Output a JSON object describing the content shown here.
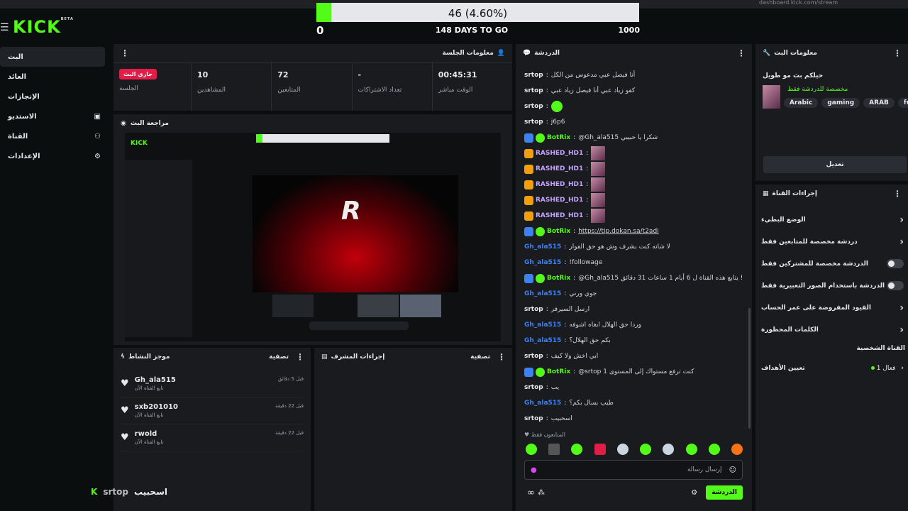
{
  "goal": {
    "label": "46 (4.60%)",
    "progress": 0.046,
    "min": "0",
    "days_left": "148 DAYS TO GO",
    "max": "1000"
  },
  "topbar": {
    "url_fragment": "dashboard.kick.com/stream",
    "logo_text": "KICK",
    "logo_sup": "BETA"
  },
  "sidebar": {
    "items": [
      {
        "label": "البث",
        "icon": ""
      },
      {
        "label": "العائد",
        "icon": ""
      },
      {
        "label": "الإنجازات",
        "icon": ""
      },
      {
        "label": "الاستديو",
        "icon": "screen-icon"
      },
      {
        "label": "القناة",
        "icon": "people-icon"
      },
      {
        "label": "الإعدادات",
        "icon": "gear-icon"
      }
    ]
  },
  "session": {
    "title": "معلومات الجلسة",
    "live_badge": "جاري البث",
    "live_label": "الجلسة",
    "stats": [
      {
        "value": "10",
        "label": "المشاهدين"
      },
      {
        "value": "72",
        "label": "المتابعين"
      },
      {
        "value": "-",
        "label": "تعداد الاشتراكات"
      },
      {
        "value": "00:45:31",
        "label": "الوقت مباشر"
      }
    ]
  },
  "preview": {
    "title": "مراجعة البث"
  },
  "activity": {
    "title": "موجز النشاط",
    "filter": "تصفية",
    "items": [
      {
        "user": "Gh_ala515",
        "desc": "تابع القناة الآن",
        "time": "قبل 5 دقائق"
      },
      {
        "user": "sxb201010",
        "desc": "تابع القناة الآن",
        "time": "قبل 22 دقيقة"
      },
      {
        "user": "rwold",
        "desc": "تابع القناة الآن",
        "time": "قبل 22 دقيقة"
      }
    ]
  },
  "mod": {
    "title": "إجراءات المشرف",
    "filter": "تصفية"
  },
  "footer_user": {
    "name": "srtop",
    "caption": "اسحبيب"
  },
  "chat": {
    "title": "الدردشة",
    "messages": [
      {
        "user": "srtop",
        "color": "#e5e7eb",
        "text": "أنا فيصل عبي مدعوس من الكل",
        "kind": "plain"
      },
      {
        "user": "srtop",
        "color": "#e5e7eb",
        "text": "كفو زياد عبي أنا فيصل زياد عبي",
        "kind": "plain"
      },
      {
        "user": "srtop",
        "color": "#e5e7eb",
        "text": "",
        "kind": "emote"
      },
      {
        "user": "srtop",
        "color": "#e5e7eb",
        "text": "j6p6",
        "kind": "plain"
      },
      {
        "user": "BotRix",
        "color": "#53fc18",
        "text": "@Gh_ala515 شكرا يا حبيبي",
        "kind": "bot"
      },
      {
        "user": "RASHED_HD1",
        "color": "#c4a2ff",
        "text": "",
        "kind": "crown"
      },
      {
        "user": "RASHED_HD1",
        "color": "#c4a2ff",
        "text": "",
        "kind": "crown"
      },
      {
        "user": "RASHED_HD1",
        "color": "#c4a2ff",
        "text": "",
        "kind": "crown"
      },
      {
        "user": "RASHED_HD1",
        "color": "#c4a2ff",
        "text": "",
        "kind": "crown"
      },
      {
        "user": "RASHED_HD1",
        "color": "#c4a2ff",
        "text": "",
        "kind": "crown"
      },
      {
        "user": "BotRix",
        "color": "#53fc18",
        "text": "https://tip.dokan.sa/t2adi",
        "kind": "bot"
      },
      {
        "user": "Gh_ala515",
        "color": "#3b82f6",
        "text": "لا شاته كنت بشرف وش هو حق الفوار",
        "kind": "plain"
      },
      {
        "user": "Gh_ala515",
        "color": "#3b82f6",
        "text": "!followage",
        "kind": "plain"
      },
      {
        "user": "BotRix",
        "color": "#53fc18",
        "text": "@Gh_ala515 يتابع هذه القناة ل 6 أيام 1 ساعات 31 دقائق !",
        "kind": "bot"
      },
      {
        "user": "Gh_ala515",
        "color": "#3b82f6",
        "text": "جوي ورني",
        "kind": "plain"
      },
      {
        "user": "srtop",
        "color": "#e5e7eb",
        "text": "ارسل السيرفر",
        "kind": "plain"
      },
      {
        "user": "Gh_ala515",
        "color": "#3b82f6",
        "text": "وردا حق الهلال ابغاه اشوفه",
        "kind": "plain"
      },
      {
        "user": "Gh_ala515",
        "color": "#3b82f6",
        "text": "بكم حق الهلال؟",
        "kind": "plain"
      },
      {
        "user": "srtop",
        "color": "#e5e7eb",
        "text": "ابي اخش ولا كيف",
        "kind": "plain"
      },
      {
        "user": "BotRix",
        "color": "#53fc18",
        "text": "@srtop كنت ترفع مستواك إلى المستوى 1",
        "kind": "bot"
      },
      {
        "user": "srtop",
        "color": "#e5e7eb",
        "text": "يب",
        "kind": "plain"
      },
      {
        "user": "Gh_ala515",
        "color": "#3b82f6",
        "text": "طيب بسال بكم؟",
        "kind": "plain"
      },
      {
        "user": "srtop",
        "color": "#e5e7eb",
        "text": "اسحبيب",
        "kind": "plain"
      }
    ],
    "followers_only": "المتابعون فقط",
    "input_placeholder": "إرسال رسالة",
    "send_label": "الدردشة"
  },
  "stream_info": {
    "title": "معلومات البث",
    "stream_title": "حيلكم بث مو طويل",
    "category": "مخصصة للدردشة فقط",
    "tags": [
      "Arabic",
      "gaming",
      "ARAB",
      "funny"
    ],
    "edit_label": "تعديل"
  },
  "channel_actions": {
    "title": "إجراءات القناة",
    "items": [
      {
        "label": "الوضع البطيء",
        "type": "arrow"
      },
      {
        "label": "دردشة مخصصة للمتابعين فقط",
        "type": "arrow"
      },
      {
        "label": "الدردشة مخصصة للمشتركين فقط",
        "type": "toggle"
      },
      {
        "label": "الدردشة باستخدام الصور التعبيرية فقط",
        "type": "toggle"
      },
      {
        "label": "القيود المفروضة على عمر الحساب",
        "type": "arrow"
      },
      {
        "label": "الكلمات المحظورة",
        "type": "arrow"
      }
    ],
    "section": "القناة الشخصية",
    "goals_label": "تعيين الأهداف",
    "goals_value": "فعال 1"
  },
  "colors": {
    "accent": "#53fc18",
    "panel": "#191b1f",
    "bg": "#0b0e0f"
  }
}
